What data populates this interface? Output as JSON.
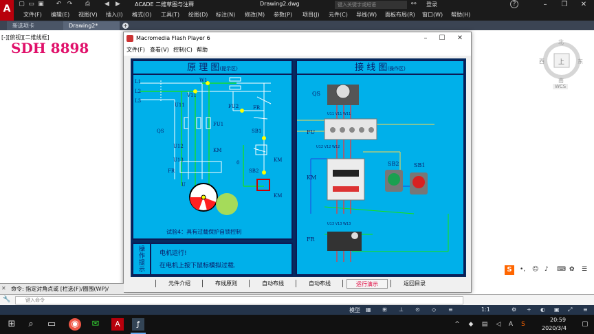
{
  "titlebar": {
    "app_icon": "A",
    "workspace": "ACADE 二维草图与注释",
    "document": "Drawing2.dwg",
    "search_placeholder": "键入关键字或短语",
    "login": "登录",
    "help": "?"
  },
  "menu": [
    "文件(F)",
    "编辑(E)",
    "视图(V)",
    "插入(I)",
    "格式(O)",
    "工具(T)",
    "绘图(D)",
    "标注(N)",
    "修改(M)",
    "参数(P)",
    "项目(J)",
    "元件(C)",
    "导线(W)",
    "面板布局(R)",
    "窗口(W)",
    "帮助(H)"
  ],
  "tabs": [
    "新选项卡",
    "Drawing2*"
  ],
  "viewport": {
    "view_label": "[-][俯视][二维线框]",
    "overlay_text": "SDH 8898"
  },
  "compass": {
    "north": "北",
    "east": "东",
    "west": "西",
    "south": "南",
    "top": "上",
    "wcs": "WCS"
  },
  "flash": {
    "title": "Macromedia Flash Player 6",
    "menu": [
      "文件(F)",
      "查看(V)",
      "控制(C)",
      "帮助"
    ],
    "left_title": "原 理 图",
    "left_sub": "(提示区)",
    "right_title": "接 线 图",
    "right_sub": "(操作区)",
    "caption": "试验4：具有过载保护自锁控制",
    "tips_label": "操作提示",
    "tip_line1": "电机运行!",
    "tip_line2": "在电机上按下鼠标模拟过载.",
    "schematic_labels": {
      "L1": "L1",
      "L2": "L2",
      "L3": "L3",
      "QS": "QS",
      "U11": "U11",
      "W1": "W1",
      "V11": "V11",
      "FU2": "FU2",
      "FU1": "FU1",
      "U12": "U12",
      "V12": "V12",
      "W12": "W12",
      "KM": "KM",
      "U13": "U13",
      "V13": "V13",
      "W13": "W13",
      "FR": "FR",
      "U": "U",
      "V": "V",
      "W": "W",
      "zero": "0",
      "n1": "1",
      "n2": "2",
      "n3": "3",
      "SB1": "SB1",
      "SB2": "SB2"
    },
    "wiring_labels": {
      "QS": "QS",
      "FU": "FU",
      "KM": "KM",
      "FR": "FR",
      "SB2": "SB2",
      "SB1": "SB1",
      "U11": "U11 V11 W11",
      "U12": "U12 V12 W12",
      "U13": "U13 V13 W13"
    },
    "buttons": [
      "元件介绍",
      "布线原则",
      "自动布线",
      "自动布线",
      "运行演示",
      "返回目录"
    ],
    "selected_button": "运行演示"
  },
  "command": {
    "history": "命令: 指定对角点或 [栏选(F)/圈围(WP)/",
    "placeholder": "键入命令"
  },
  "status": {
    "model": "模型",
    "scale": "1:1"
  },
  "taskbar": {
    "time": "20:59",
    "date": "2020/3/4",
    "ime": "A"
  },
  "colors": {
    "panel": "#00b0ea",
    "stage": "#062a5e",
    "accent": "#e0106a",
    "motor": "#ff2020"
  }
}
